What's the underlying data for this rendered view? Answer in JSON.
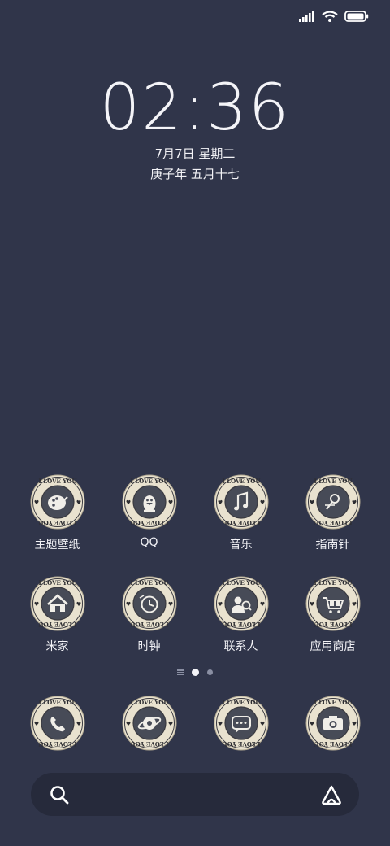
{
  "status": {
    "icons": [
      "signal-icon",
      "wifi-icon",
      "battery-icon"
    ]
  },
  "lockscreen": {
    "time": "02:36",
    "date": "7月7日 星期二",
    "lunar": "庚子年 五月十七"
  },
  "badge_text": "I LOVE YOU",
  "apps_row1": [
    {
      "label": "主题壁纸",
      "icon": "palette-icon"
    },
    {
      "label": "QQ",
      "icon": "penguin-icon"
    },
    {
      "label": "音乐",
      "icon": "music-note-icon"
    },
    {
      "label": "指南针",
      "icon": "compass-icon"
    }
  ],
  "apps_row2": [
    {
      "label": "米家",
      "icon": "home-icon"
    },
    {
      "label": "时钟",
      "icon": "clock-icon"
    },
    {
      "label": "联系人",
      "icon": "contacts-icon"
    },
    {
      "label": "应用商店",
      "icon": "shopping-cart-icon"
    }
  ],
  "dock": [
    {
      "icon": "phone-icon"
    },
    {
      "icon": "browser-icon"
    },
    {
      "icon": "message-icon"
    },
    {
      "icon": "camera-icon"
    }
  ],
  "page_indicator": {
    "pages": 2,
    "current": 1
  },
  "search": {
    "icon": "search-icon",
    "right_icon": "assistant-icon"
  },
  "colors": {
    "background": "#30354a",
    "badge_ring": "#e9e2cf",
    "badge_inner": "#474b57",
    "badge_text": "#2c2c30"
  }
}
